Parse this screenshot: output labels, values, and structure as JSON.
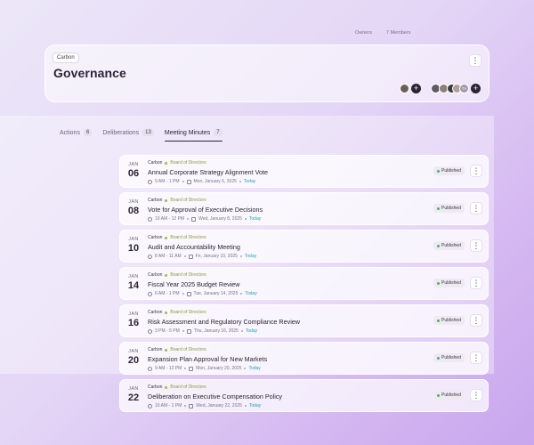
{
  "header": {
    "workspace": "Carbon",
    "title": "Governance",
    "owners_label": "Owners",
    "members_label": "7 Members",
    "menu_icon": "more-vertical-icon",
    "owners": [
      {
        "color": "#6b5e58"
      }
    ],
    "members": [
      {
        "color": "#5f5a64"
      },
      {
        "color": "#8b7f78"
      },
      {
        "color": "#3b3a3f"
      },
      {
        "color": "#b09f95"
      },
      {
        "color": "#9e98a6",
        "initials": "TA"
      }
    ]
  },
  "tabs": [
    {
      "label": "Actions",
      "count": "6"
    },
    {
      "label": "Deliberations",
      "count": "13"
    },
    {
      "label": "Meeting Minutes",
      "count": "7",
      "active": true
    }
  ],
  "rows": [
    {
      "month": "JAN",
      "day": "06",
      "org": "Carbon",
      "group": "Board of Directors",
      "title": "Annual Corporate Strategy Alignment Vote",
      "time": "9 AM - 1 PM",
      "date": "Mon, January 6, 2025",
      "rel": "Today",
      "status": "Published"
    },
    {
      "month": "JAN",
      "day": "08",
      "org": "Carbon",
      "group": "Board of Directors",
      "title": "Vote for Approval of Executive Decisions",
      "time": "10 AM - 12 PM",
      "date": "Wed, January 8, 2025",
      "rel": "Today",
      "status": "Published"
    },
    {
      "month": "JAN",
      "day": "10",
      "org": "Carbon",
      "group": "Board of Directors",
      "title": "Audit and Accountability Meeting",
      "time": "8 AM - 11 AM",
      "date": "Fri, January 10, 2025",
      "rel": "Today",
      "status": "Published"
    },
    {
      "month": "JAN",
      "day": "14",
      "org": "Carbon",
      "group": "Board of Directors",
      "title": "Fiscal Year 2025 Budget Review",
      "time": "6 AM - 1 PM",
      "date": "Tue, January 14, 2025",
      "rel": "Today",
      "status": "Published"
    },
    {
      "month": "JAN",
      "day": "16",
      "org": "Carbon",
      "group": "Board of Directors",
      "title": "Risk Assessment and Regulatory Compliance Review",
      "time": "3 PM - 5 PM",
      "date": "Thu, January 16, 2025",
      "rel": "Today",
      "status": "Published"
    },
    {
      "month": "JAN",
      "day": "20",
      "org": "Carbon",
      "group": "Board of Directors",
      "title": "Expansion Plan Approval for New Markets",
      "time": "9 AM - 12 PM",
      "date": "Mon, January 20, 2025",
      "rel": "Today",
      "status": "Published"
    },
    {
      "month": "JAN",
      "day": "22",
      "org": "Carbon",
      "group": "Board of Directors",
      "title": "Deliberation on Executive Compensation Policy",
      "time": "10 AM - 1 PM",
      "date": "Wed, January 22, 2025",
      "rel": "Today",
      "status": "Published"
    }
  ]
}
